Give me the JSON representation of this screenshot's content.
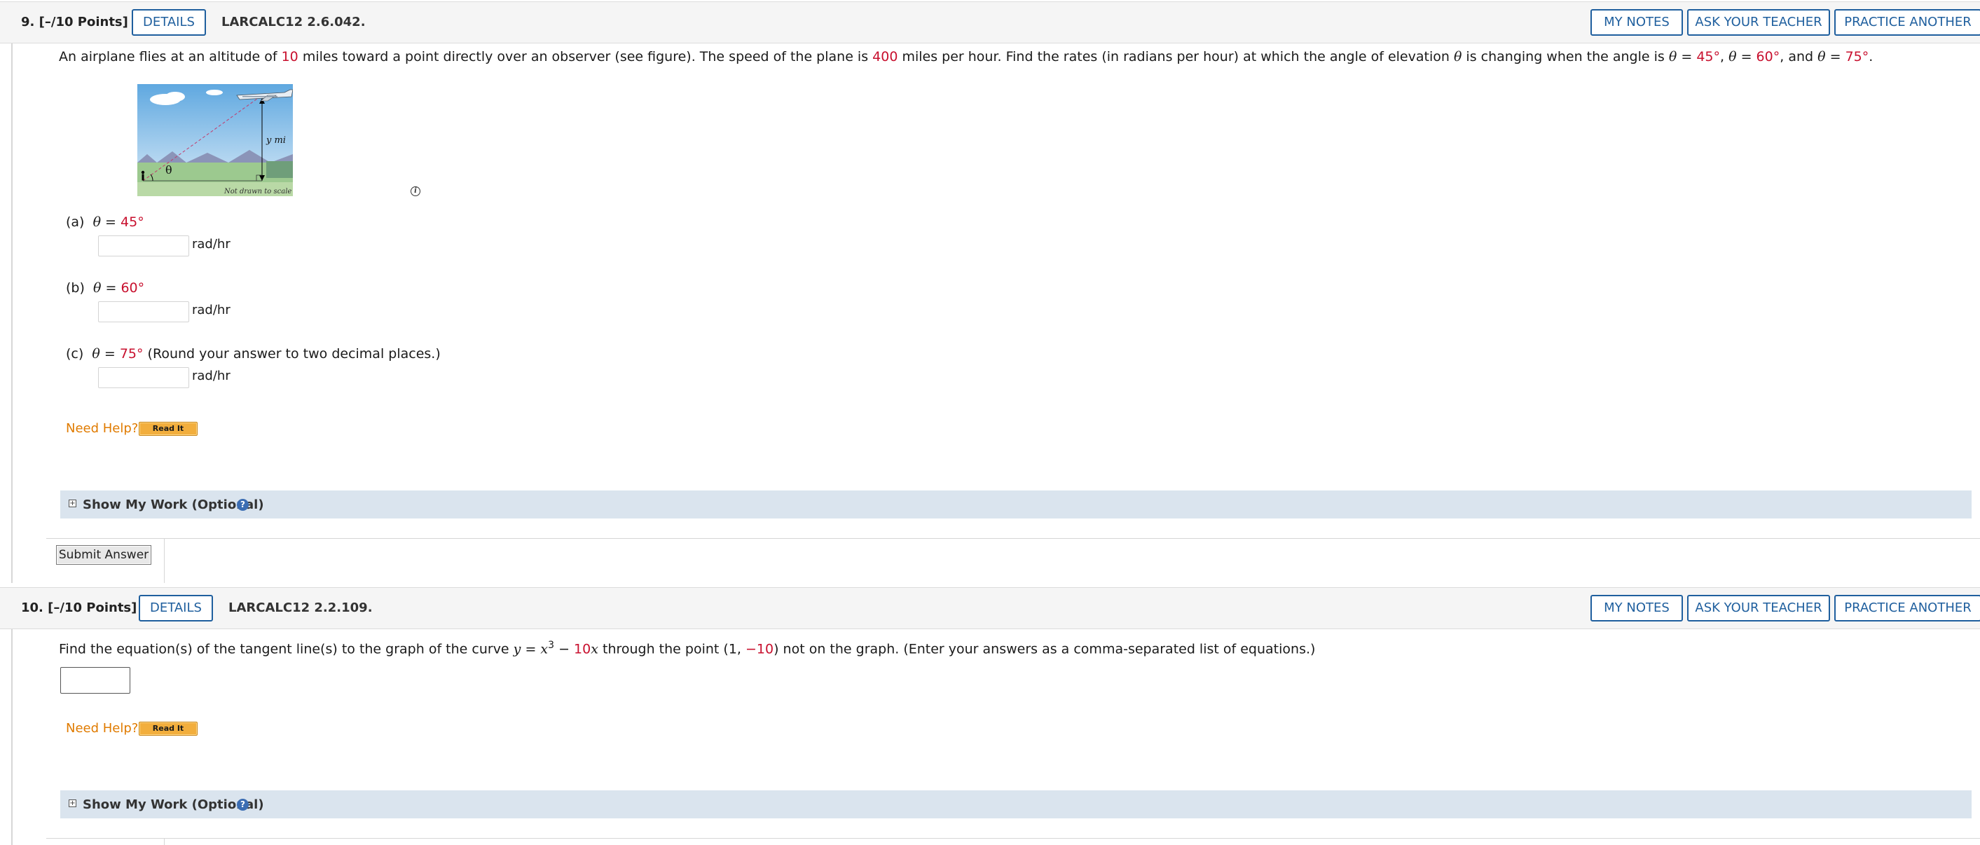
{
  "q9": {
    "number": "9.",
    "points": "[–/10 Points]",
    "details_label": "DETAILS",
    "ref": "LARCALC12 2.6.042.",
    "my_notes_label": "MY NOTES",
    "ask_teacher_label": "ASK YOUR TEACHER",
    "practice_label": "PRACTICE ANOTHER",
    "prompt": {
      "t1": "An airplane flies at an altitude of ",
      "altitude": "10",
      "t2": " miles toward a point directly over an observer (see figure). The speed of the plane is ",
      "speed": "400",
      "t3": " miles per hour. Find the rates (in radians per hour) at which the angle of elevation ",
      "theta": "θ",
      "t4": " is changing when the angle is ",
      "eq": " = ",
      "a1": "45°",
      "sep": ", ",
      "a2": "60°",
      "and": ", and ",
      "a3": "75°",
      "end": "."
    },
    "figure": {
      "y_label": "y mi",
      "theta_label": "θ",
      "caption": "Not drawn to scale"
    },
    "parts": [
      {
        "label": "(a)",
        "theta": "θ",
        "eq": " = ",
        "value": "45°",
        "note": "",
        "input_value": "",
        "unit": "rad/hr"
      },
      {
        "label": "(b)",
        "theta": "θ",
        "eq": " = ",
        "value": "60°",
        "note": "",
        "input_value": "",
        "unit": "rad/hr"
      },
      {
        "label": "(c)",
        "theta": "θ",
        "eq": " = ",
        "value": "75°",
        "note": " (Round your answer to two decimal places.)",
        "input_value": "",
        "unit": "rad/hr"
      }
    ],
    "need_help": "Need Help?",
    "read_it": "Read It",
    "show_work": "Show My Work (Optional)",
    "submit": "Submit Answer"
  },
  "q10": {
    "number": "10.",
    "points": "[–/10 Points]",
    "details_label": "DETAILS",
    "ref": "LARCALC12 2.2.109.",
    "my_notes_label": "MY NOTES",
    "ask_teacher_label": "ASK YOUR TEACHER",
    "practice_label": "PRACTICE ANOTHER",
    "prompt": {
      "t1": "Find the equation(s) of the tangent line(s) to the graph of the curve ",
      "y": "y",
      "eq": " = ",
      "x": "x",
      "exp": "3",
      "minus": " − ",
      "coef": "10",
      "x2": "x",
      "t2": " through the point (1, ",
      "point_y": "−10",
      "t3": ") not on the graph. (Enter your answers as a comma-separated list of equations.)"
    },
    "input_value": "",
    "need_help": "Need Help?",
    "read_it": "Read It",
    "show_work": "Show My Work (Optional)"
  },
  "colors": {
    "accent": "#1f5f9e",
    "highlight_red": "#c8102e",
    "need_help": "#e07b00",
    "show_work_bg": "#dae4ee"
  }
}
